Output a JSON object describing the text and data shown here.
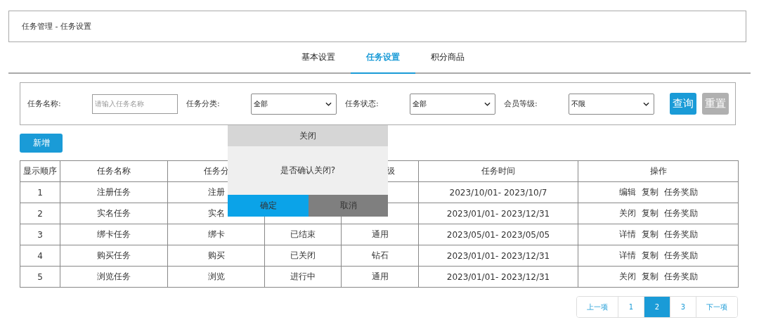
{
  "breadcrumb": "任务管理 - 任务设置",
  "tabs": [
    {
      "label": "基本设置",
      "selected": false
    },
    {
      "label": "任务设置",
      "selected": true
    },
    {
      "label": "积分商品",
      "selected": false
    }
  ],
  "filters": [
    {
      "kind": "input",
      "label": "任务名称:",
      "placeholder": "请输入任务名称"
    },
    {
      "kind": "select",
      "label": "任务分类:",
      "value": "全部"
    },
    {
      "kind": "select",
      "label": "任务状态:",
      "value": "全部"
    },
    {
      "kind": "select",
      "label": "会员等级:",
      "value": "不限"
    }
  ],
  "filter_buttons": [
    {
      "label": "查询",
      "kind": "primary"
    },
    {
      "label": "重置",
      "kind": "secondary"
    }
  ],
  "add_button": "新增",
  "table": {
    "columns": [
      "显示顺序",
      "任务名称",
      "任务分",
      "",
      "级",
      "任务时间",
      "操作"
    ],
    "rows": [
      {
        "cells": [
          "1",
          "注册任务",
          "注册",
          "",
          "",
          "2023/10/01- 2023/10/7"
        ],
        "actions": [
          "编辑",
          "复制",
          "任务奖励"
        ]
      },
      {
        "cells": [
          "2",
          "实名任务",
          "实名",
          "",
          "",
          "2023/01/01- 2023/12/31"
        ],
        "actions": [
          "关闭",
          "复制",
          "任务奖励"
        ]
      },
      {
        "cells": [
          "3",
          "绑卡任务",
          "绑卡",
          "已结束",
          "通用",
          "2023/05/01- 2023/05/05"
        ],
        "actions": [
          "详情",
          "复制",
          "任务奖励"
        ]
      },
      {
        "cells": [
          "4",
          "购买任务",
          "购买",
          "已关闭",
          "钻石",
          "2023/01/01- 2023/12/31"
        ],
        "actions": [
          "详情",
          "复制",
          "任务奖励"
        ]
      },
      {
        "cells": [
          "5",
          "浏览任务",
          "浏览",
          "进行中",
          "通用",
          "2023/01/01- 2023/12/31"
        ],
        "actions": [
          "关闭",
          "复制",
          "任务奖励"
        ]
      }
    ]
  },
  "dialog": {
    "title": "关闭",
    "message": "是否确认关闭?",
    "buttons": [
      {
        "label": "确定",
        "kind": "confirm"
      },
      {
        "label": "取消",
        "kind": "cancel"
      }
    ]
  },
  "pagination": [
    {
      "label": "上一项",
      "selected": false
    },
    {
      "label": "1",
      "selected": false
    },
    {
      "label": "2",
      "selected": true
    },
    {
      "label": "3",
      "selected": false
    },
    {
      "label": "下一项",
      "selected": false
    }
  ]
}
